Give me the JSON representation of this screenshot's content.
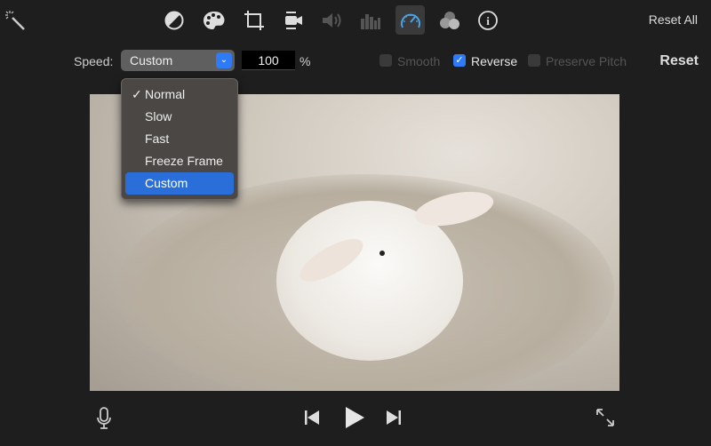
{
  "toolbar": {
    "tools": [
      {
        "icon": "magic-wand-icon"
      },
      {
        "icon": "color-balance-icon"
      },
      {
        "icon": "color-palette-icon"
      },
      {
        "icon": "crop-icon"
      },
      {
        "icon": "stabilization-camera-icon"
      },
      {
        "icon": "volume-icon"
      },
      {
        "icon": "equalizer-icon"
      },
      {
        "icon": "speed-gauge-icon",
        "selected": true
      },
      {
        "icon": "filters-icon"
      },
      {
        "icon": "info-icon"
      }
    ],
    "reset_all": "Reset All"
  },
  "speed": {
    "label": "Speed:",
    "selected": "Custom",
    "value": "100",
    "unit": "%",
    "options": [
      "Normal",
      "Slow",
      "Fast",
      "Freeze Frame",
      "Custom"
    ],
    "checked_option": "Normal",
    "highlighted_option": "Custom",
    "smooth": {
      "label": "Smooth",
      "checked": false,
      "enabled": false
    },
    "reverse": {
      "label": "Reverse",
      "checked": true,
      "enabled": true
    },
    "preserve_pitch": {
      "label": "Preserve Pitch",
      "checked": false,
      "enabled": false
    },
    "reset": "Reset",
    "check_mark": "✓"
  },
  "colors": {
    "accent": "#2f7bf5",
    "background": "#1e1e1e",
    "speed_icon": "#4aa3e8"
  },
  "playback": {
    "icons": [
      "microphone-icon",
      "skip-back-icon",
      "play-icon",
      "skip-forward-icon",
      "fullscreen-icon"
    ]
  }
}
